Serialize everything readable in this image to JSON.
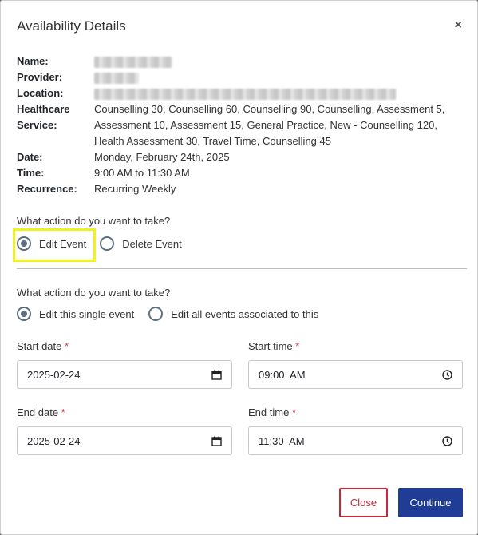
{
  "modal": {
    "title": "Availability Details",
    "close_icon": "×"
  },
  "details": {
    "name_label": "Name:",
    "provider_label": "Provider:",
    "location_label": "Location:",
    "healthcare_label": "Healthcare",
    "service_label": "Service:",
    "healthcare_services": [
      "Counselling 30, Counselling 60, Counselling 90, Counselling, Assessment 5,",
      "Assessment 10, Assessment 15, General Practice, New - Counselling 120,",
      "Health Assessment 30, Travel Time, Counselling 45"
    ],
    "date_label": "Date:",
    "date_value": "Monday, February 24th, 2025",
    "time_label": "Time:",
    "time_value": "9:00 AM to 11:30 AM",
    "recurrence_label": "Recurrence:",
    "recurrence_value": "Recurring Weekly"
  },
  "action1": {
    "question": "What action do you want to take?",
    "options": [
      "Edit Event",
      "Delete Event"
    ],
    "selected": "Edit Event"
  },
  "action2": {
    "question": "What action do you want to take?",
    "options": [
      "Edit this single event",
      "Edit all events associated to this"
    ],
    "selected": "Edit this single event"
  },
  "form": {
    "start_date_label": "Start date",
    "start_date_value": "2025-02-24",
    "start_time_label": "Start time",
    "start_time_value": "09:00  AM",
    "end_date_label": "End date",
    "end_date_value": "2025-02-24",
    "end_time_label": "End time",
    "end_time_value": "11:30  AM",
    "required_mark": "*"
  },
  "buttons": {
    "close_label": "Close",
    "continue_label": "Continue"
  },
  "colors": {
    "primary": "#1f3d96",
    "danger": "#c8273a",
    "highlight": "#f0f21c",
    "radio": "#5c6f80"
  }
}
